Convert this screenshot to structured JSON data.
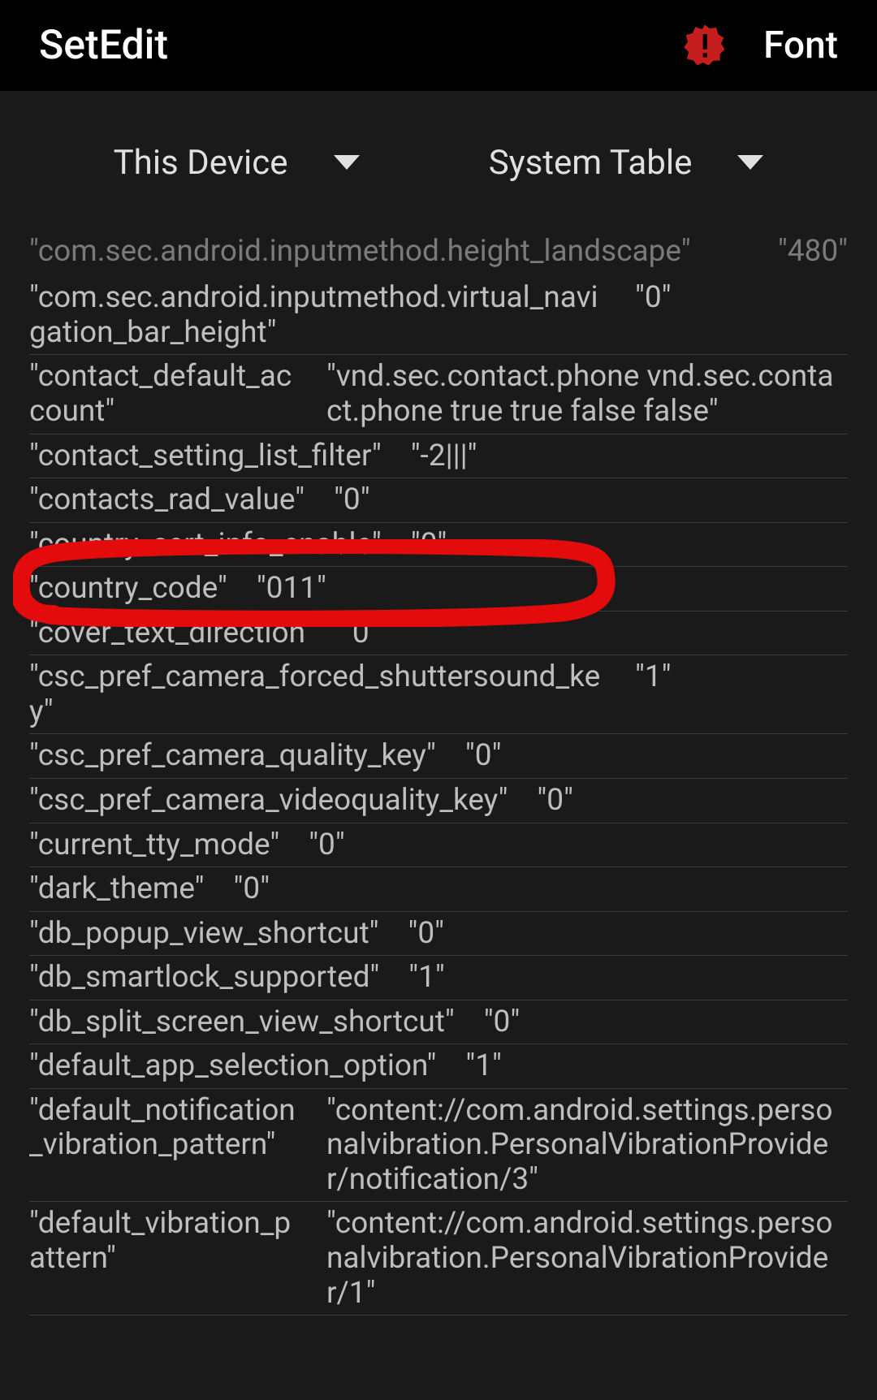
{
  "header": {
    "title": "SetEdit",
    "font_label": "Font"
  },
  "dropdowns": {
    "device": "This Device",
    "table": "System Table"
  },
  "partial_row": {
    "key": "\"com.sec.android.inputmethod.height_landscape\"",
    "value": "\"480\""
  },
  "rows": [
    {
      "key": "\"com.sec.android.inputmethod.virtual_navigation_bar_height\"",
      "value": "\"0\"",
      "wrap": false
    },
    {
      "key": "\"contact_default_account\"",
      "value": "\"vnd.sec.contact.phone vnd.sec.contact.phone  true true false false\"",
      "wrap": true
    },
    {
      "key": "\"contact_setting_list_filter\"",
      "value": "\"-2|||\"",
      "wrap": false
    },
    {
      "key": "\"contacts_rad_value\"",
      "value": "\"0\"",
      "wrap": false
    },
    {
      "key": "\"country_cert_info_enable\"",
      "value": "\"0\"",
      "wrap": false
    },
    {
      "key": "\"country_code\"",
      "value": "\"011\"",
      "wrap": false
    },
    {
      "key": "\"cover_text_direction\"",
      "value": "\"0\"",
      "wrap": false
    },
    {
      "key": "\"csc_pref_camera_forced_shuttersound_key\"",
      "value": "\"1\"",
      "wrap": false
    },
    {
      "key": "\"csc_pref_camera_quality_key\"",
      "value": "\"0\"",
      "wrap": false
    },
    {
      "key": "\"csc_pref_camera_videoquality_key\"",
      "value": "\"0\"",
      "wrap": false
    },
    {
      "key": "\"current_tty_mode\"",
      "value": "\"0\"",
      "wrap": false
    },
    {
      "key": "\"dark_theme\"",
      "value": "\"0\"",
      "wrap": false
    },
    {
      "key": "\"db_popup_view_shortcut\"",
      "value": "\"0\"",
      "wrap": false
    },
    {
      "key": "\"db_smartlock_supported\"",
      "value": "\"1\"",
      "wrap": false
    },
    {
      "key": "\"db_split_screen_view_shortcut\"",
      "value": "\"0\"",
      "wrap": false
    },
    {
      "key": "\"default_app_selection_option\"",
      "value": "\"1\"",
      "wrap": false
    },
    {
      "key": "\"default_notification_vibration_pattern\"",
      "value": "\"content://com.android.settings.personalvibration.PersonalVibrationProvider/notification/3\"",
      "wrap": true
    },
    {
      "key": "\"default_vibration_pattern\"",
      "value": "\"content://com.android.settings.personalvibration.PersonalVibrationProvider/1\"",
      "wrap": true
    }
  ]
}
